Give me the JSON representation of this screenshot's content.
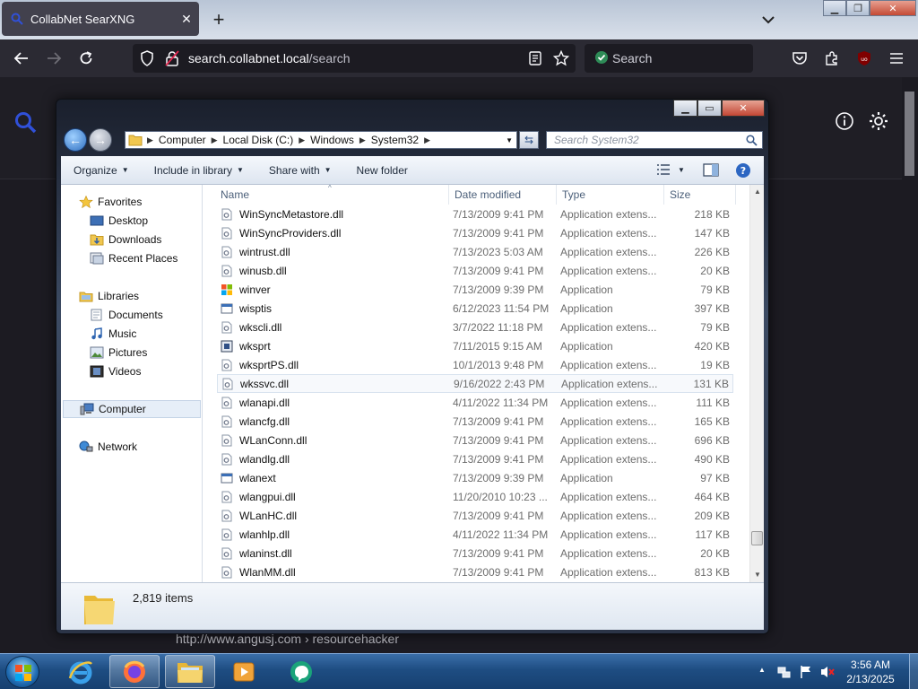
{
  "browser": {
    "tab_title": "CollabNet SearXNG",
    "url_host": "search.collabnet.local",
    "url_path": "/search",
    "search_placeholder": "Search"
  },
  "page": {
    "footer_url": "http://www.angusj.com › resourcehacker"
  },
  "explorer": {
    "breadcrumb": [
      "Computer",
      "Local Disk (C:)",
      "Windows",
      "System32"
    ],
    "search_placeholder": "Search System32",
    "toolbar": {
      "organize": "Organize",
      "include": "Include in library",
      "share": "Share with",
      "new_folder": "New folder"
    },
    "nav": {
      "favorites": "Favorites",
      "desktop": "Desktop",
      "downloads": "Downloads",
      "recent": "Recent Places",
      "libraries": "Libraries",
      "documents": "Documents",
      "music": "Music",
      "pictures": "Pictures",
      "videos": "Videos",
      "computer": "Computer",
      "network": "Network"
    },
    "columns": {
      "name": "Name",
      "date": "Date modified",
      "type": "Type",
      "size": "Size"
    },
    "files": [
      {
        "name": "WinSyncMetastore.dll",
        "date": "7/13/2009 9:41 PM",
        "type": "Application extens...",
        "size": "218 KB",
        "icon": "dll-icon"
      },
      {
        "name": "WinSyncProviders.dll",
        "date": "7/13/2009 9:41 PM",
        "type": "Application extens...",
        "size": "147 KB",
        "icon": "dll-icon"
      },
      {
        "name": "wintrust.dll",
        "date": "7/13/2023 5:03 AM",
        "type": "Application extens...",
        "size": "226 KB",
        "icon": "dll-icon"
      },
      {
        "name": "winusb.dll",
        "date": "7/13/2009 9:41 PM",
        "type": "Application extens...",
        "size": "20 KB",
        "icon": "dll-icon"
      },
      {
        "name": "winver",
        "date": "7/13/2009 9:39 PM",
        "type": "Application",
        "size": "79 KB",
        "icon": "windows-flag-icon"
      },
      {
        "name": "wisptis",
        "date": "6/12/2023 11:54 PM",
        "type": "Application",
        "size": "397 KB",
        "icon": "exe-icon"
      },
      {
        "name": "wkscli.dll",
        "date": "3/7/2022 11:18 PM",
        "type": "Application extens...",
        "size": "79 KB",
        "icon": "dll-icon"
      },
      {
        "name": "wksprt",
        "date": "7/11/2015 9:15 AM",
        "type": "Application",
        "size": "420 KB",
        "icon": "remoteapp-icon"
      },
      {
        "name": "wksprtPS.dll",
        "date": "10/1/2013 9:48 PM",
        "type": "Application extens...",
        "size": "19 KB",
        "icon": "dll-icon"
      },
      {
        "name": "wkssvc.dll",
        "date": "9/16/2022 2:43 PM",
        "type": "Application extens...",
        "size": "131 KB",
        "icon": "dll-icon"
      },
      {
        "name": "wlanapi.dll",
        "date": "4/11/2022 11:34 PM",
        "type": "Application extens...",
        "size": "111 KB",
        "icon": "dll-icon"
      },
      {
        "name": "wlancfg.dll",
        "date": "7/13/2009 9:41 PM",
        "type": "Application extens...",
        "size": "165 KB",
        "icon": "dll-icon"
      },
      {
        "name": "WLanConn.dll",
        "date": "7/13/2009 9:41 PM",
        "type": "Application extens...",
        "size": "696 KB",
        "icon": "dll-icon"
      },
      {
        "name": "wlandlg.dll",
        "date": "7/13/2009 9:41 PM",
        "type": "Application extens...",
        "size": "490 KB",
        "icon": "dll-icon"
      },
      {
        "name": "wlanext",
        "date": "7/13/2009 9:39 PM",
        "type": "Application",
        "size": "97 KB",
        "icon": "exe-icon"
      },
      {
        "name": "wlangpui.dll",
        "date": "11/20/2010 10:23 ...",
        "type": "Application extens...",
        "size": "464 KB",
        "icon": "dll-icon"
      },
      {
        "name": "WLanHC.dll",
        "date": "7/13/2009 9:41 PM",
        "type": "Application extens...",
        "size": "209 KB",
        "icon": "dll-icon"
      },
      {
        "name": "wlanhlp.dll",
        "date": "4/11/2022 11:34 PM",
        "type": "Application extens...",
        "size": "117 KB",
        "icon": "dll-icon"
      },
      {
        "name": "wlaninst.dll",
        "date": "7/13/2009 9:41 PM",
        "type": "Application extens...",
        "size": "20 KB",
        "icon": "dll-icon"
      },
      {
        "name": "WlanMM.dll",
        "date": "7/13/2009 9:41 PM",
        "type": "Application extens...",
        "size": "813 KB",
        "icon": "dll-icon"
      }
    ],
    "highlighted_index": 9,
    "status": "2,819 items"
  },
  "taskbar": {
    "time": "3:56 AM",
    "date": "2/13/2025"
  },
  "colors": {
    "firefox_dark": "#2b2a33",
    "search_accent": "#3050d8",
    "taskbar": "#1e4d82"
  }
}
